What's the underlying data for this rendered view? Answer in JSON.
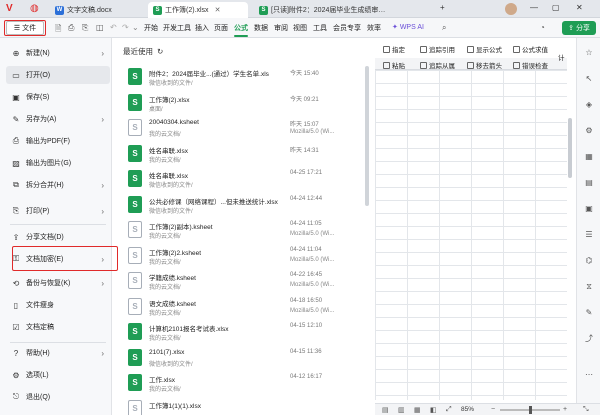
{
  "tabs": [
    {
      "label": "文字文稿.docx",
      "icon": "word-doc-icon",
      "color": "#2b6fd8"
    },
    {
      "label": "工作簿(2).xlsx",
      "icon": "sheet-doc-icon",
      "color": "#1f9d55"
    },
    {
      "label": "[只读]附件2：2024届毕业生成绩审…",
      "icon": "sheet-doc-icon",
      "color": "#1f9d55"
    }
  ],
  "ribbon": {
    "file_label": "文件",
    "menus": [
      "开始",
      "开发工具",
      "插入",
      "页面",
      "公式",
      "数据",
      "审阅",
      "视图",
      "工具",
      "会员专享",
      "效率"
    ],
    "active_menu": "公式",
    "wps_ai": "WPS AI",
    "share": "分享",
    "tools": {
      "t1": "指定",
      "t2": "追踪引用",
      "t3": "显示公式",
      "t4": "公式求值",
      "t5": "粘贴",
      "t6": "追踪从属",
      "t7": "移去箭头",
      "t8": "错误检查",
      "t9": "计"
    }
  },
  "file_menu": {
    "items": [
      {
        "label": "新建(N)",
        "icon": "new-doc-icon",
        "arrow": true
      },
      {
        "label": "打开(O)",
        "icon": "folder-open-icon",
        "arrow": false
      },
      {
        "label": "保存(S)",
        "icon": "save-icon",
        "arrow": false
      },
      {
        "label": "另存为(A)",
        "icon": "save-as-icon",
        "arrow": true
      },
      {
        "label": "输出为PDF(F)",
        "icon": "pdf-export-icon",
        "arrow": false
      },
      {
        "label": "输出为图片(G)",
        "icon": "image-export-icon",
        "arrow": false
      },
      {
        "label": "拆分合并(H)",
        "icon": "split-merge-icon",
        "arrow": true
      },
      {
        "label": "打印(P)",
        "icon": "print-icon",
        "arrow": true
      },
      {
        "label": "分享文档(D)",
        "icon": "share-doc-icon",
        "arrow": false
      },
      {
        "label": "文档加密(E)",
        "icon": "doc-encrypt-icon",
        "arrow": true
      },
      {
        "label": "备份与恢复(K)",
        "icon": "backup-icon",
        "arrow": true
      },
      {
        "label": "文件瘦身",
        "icon": "file-slim-icon",
        "arrow": false
      },
      {
        "label": "文档定稿",
        "icon": "doc-finalize-icon",
        "arrow": false
      },
      {
        "label": "帮助(H)",
        "icon": "help-icon",
        "arrow": true
      },
      {
        "label": "选项(L)",
        "icon": "options-icon",
        "arrow": false
      },
      {
        "label": "退出(Q)",
        "icon": "exit-icon",
        "arrow": false
      }
    ]
  },
  "recent": {
    "title": "最近使用",
    "files": [
      {
        "name": "附件2：2024届毕业...(通过）学生名单.xls",
        "path": "微信收到的文件/",
        "time": "今天 15:40",
        "source": "",
        "kind": "xlsx"
      },
      {
        "name": "工作簿(2).xlsx",
        "path": "桌面/",
        "time": "今天 09:21",
        "source": "",
        "kind": "xlsx"
      },
      {
        "name": "20040304.ksheet",
        "path": "我的云文档/",
        "time": "昨天 15:07",
        "source": "Mozilla/5.0 (Wi...",
        "kind": "ks"
      },
      {
        "name": "姓名串联.xlsx",
        "path": "我的云文档/",
        "time": "昨天 14:31",
        "source": "",
        "kind": "xlsx"
      },
      {
        "name": "姓名串联.xlsx",
        "path": "微信收到的文件/",
        "time": "04-25 17:21",
        "source": "",
        "kind": "xlsx"
      },
      {
        "name": "公共必修课（网络课程）...但未推送统计.xlsx",
        "path": "微信收到的文件/",
        "time": "04-24 12:44",
        "source": "",
        "kind": "xlsx"
      },
      {
        "name": "工作簿(2)副本).ksheet",
        "path": "我的云文档/",
        "time": "04-24 11:05",
        "source": "Mozilla/5.0 (Wi...",
        "kind": "ks"
      },
      {
        "name": "工作簿(2)2.ksheet",
        "path": "我的云文档/",
        "time": "04-24 11:04",
        "source": "Mozilla/5.0 (Wi...",
        "kind": "ks"
      },
      {
        "name": "学籍成绩.ksheet",
        "path": "我的云文档/",
        "time": "04-22 16:45",
        "source": "Mozilla/5.0 (Wi...",
        "kind": "ks"
      },
      {
        "name": "语文成绩.ksheet",
        "path": "我的云文档/",
        "time": "04-18 16:50",
        "source": "Mozilla/5.0 (Wi...",
        "kind": "ks"
      },
      {
        "name": "计算机2101报名考试表.xlsx",
        "path": "我的云文档/",
        "time": "04-15 12:10",
        "source": "",
        "kind": "xlsx"
      },
      {
        "name": "2101(7).xlsx",
        "path": "微信收到的文件/",
        "time": "04-15 11:36",
        "source": "",
        "kind": "xlsx"
      },
      {
        "name": "工作.xlsx",
        "path": "我的云文档/",
        "time": "04-12 16:17",
        "source": "",
        "kind": "xlsx"
      },
      {
        "name": "工作簿1(1)(1).xlsx",
        "path": "",
        "time": "",
        "source": "",
        "kind": "ks"
      }
    ]
  },
  "status": {
    "zoom": "85%",
    "zoom_level": 0.5
  },
  "colors": {
    "accent": "#1f9d55",
    "highlight": "#e02a2a"
  }
}
